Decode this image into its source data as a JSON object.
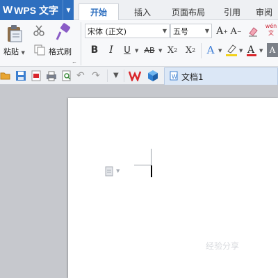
{
  "app": {
    "logo": "W",
    "name": "WPS 文字"
  },
  "tabs": [
    {
      "label": "开始",
      "active": true
    },
    {
      "label": "插入"
    },
    {
      "label": "页面布局"
    },
    {
      "label": "引用"
    },
    {
      "label": "审阅"
    }
  ],
  "clipboard": {
    "paste_label": "粘贴",
    "format_painter_label": "格式刷"
  },
  "font": {
    "family": "宋体 (正文)",
    "size": "五号"
  },
  "phonetic_label": "wén 文",
  "document": {
    "tab_name": "文档1"
  },
  "watermark": "经验分享",
  "colors": {
    "brand": "#2e6fbf",
    "highlight": "#f2d11a",
    "font_color": "#d9262b",
    "wps_red": "#d9262b"
  }
}
